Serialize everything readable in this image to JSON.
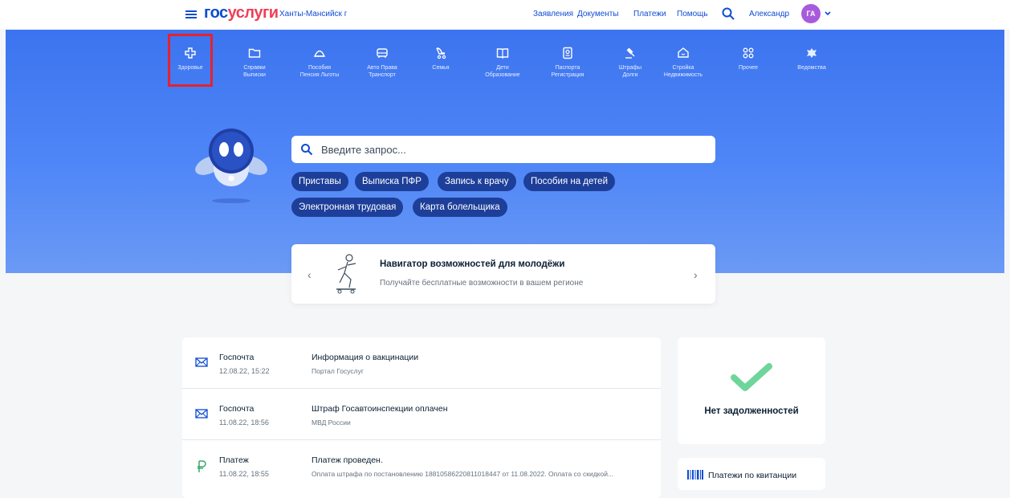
{
  "header": {
    "logo_gos": "гос",
    "logo_uslugi": "услуги",
    "region": "Ханты-Мансийск г",
    "nav": [
      "Заявления",
      "Документы",
      "Платежи",
      "Помощь"
    ],
    "user_name": "Александр",
    "avatar_initials": "ГА",
    "icons": [
      "menu-icon",
      "search-icon",
      "chevron-down-icon"
    ]
  },
  "categories": [
    {
      "l1": "Здоровье",
      "l2": "",
      "icon": "health-cross-icon"
    },
    {
      "l1": "Справки",
      "l2": "Выписки",
      "icon": "folder-icon"
    },
    {
      "l1": "Пособия",
      "l2": "Пенсия Льготы",
      "icon": "umbrella-icon"
    },
    {
      "l1": "Авто Права",
      "l2": "Транспорт",
      "icon": "car-icon"
    },
    {
      "l1": "Семья",
      "l2": "",
      "icon": "stroller-icon"
    },
    {
      "l1": "Дети",
      "l2": "Образование",
      "icon": "book-icon"
    },
    {
      "l1": "Паспорта",
      "l2": "Регистрация",
      "icon": "passport-icon"
    },
    {
      "l1": "Штрафы",
      "l2": "Долги",
      "icon": "gavel-icon"
    },
    {
      "l1": "Стройка",
      "l2": "Недвижимость",
      "icon": "house-icon"
    },
    {
      "l1": "Прочее",
      "l2": "",
      "icon": "grid-icon"
    },
    {
      "l1": "Ведомства",
      "l2": "",
      "icon": "emblem-icon"
    }
  ],
  "search": {
    "placeholder": "Введите запрос...",
    "chips": [
      "Приставы",
      "Выписка ПФР",
      "Запись к врачу",
      "Пособия на детей",
      "Электронная трудовая",
      "Карта болельщика"
    ]
  },
  "banner": {
    "title": "Навигатор возможностей для молодёжи",
    "subtitle": "Получайте бесплатные возможности в вашем регионе"
  },
  "feed": [
    {
      "source": "Госпочта",
      "date": "12.08.22, 15:22",
      "title": "Информация о вакцинации",
      "desc": "Портал Госуслуг",
      "icon": "mail-icon"
    },
    {
      "source": "Госпочта",
      "date": "11.08.22, 18:56",
      "title": "Штраф Госавтоинспекции оплачен",
      "desc": "МВД России",
      "icon": "mail-icon"
    },
    {
      "source": "Платеж",
      "date": "11.08.22, 18:55",
      "title": "Платеж проведен.",
      "desc": "Оплата штрафа по постановлению 18810586220811018447 от 11.08.2022. Оплата со скидкой...",
      "icon": "ruble-icon"
    }
  ],
  "debt": {
    "text": "Нет задолженностей"
  },
  "receipt": {
    "text": "Платежи по квитанции"
  },
  "colors": {
    "brand_blue": "#0d4cd3",
    "brand_red": "#ee3f58",
    "chip": "#1d3f9a",
    "highlight": "#e5222f",
    "check": "#6fd59a"
  }
}
